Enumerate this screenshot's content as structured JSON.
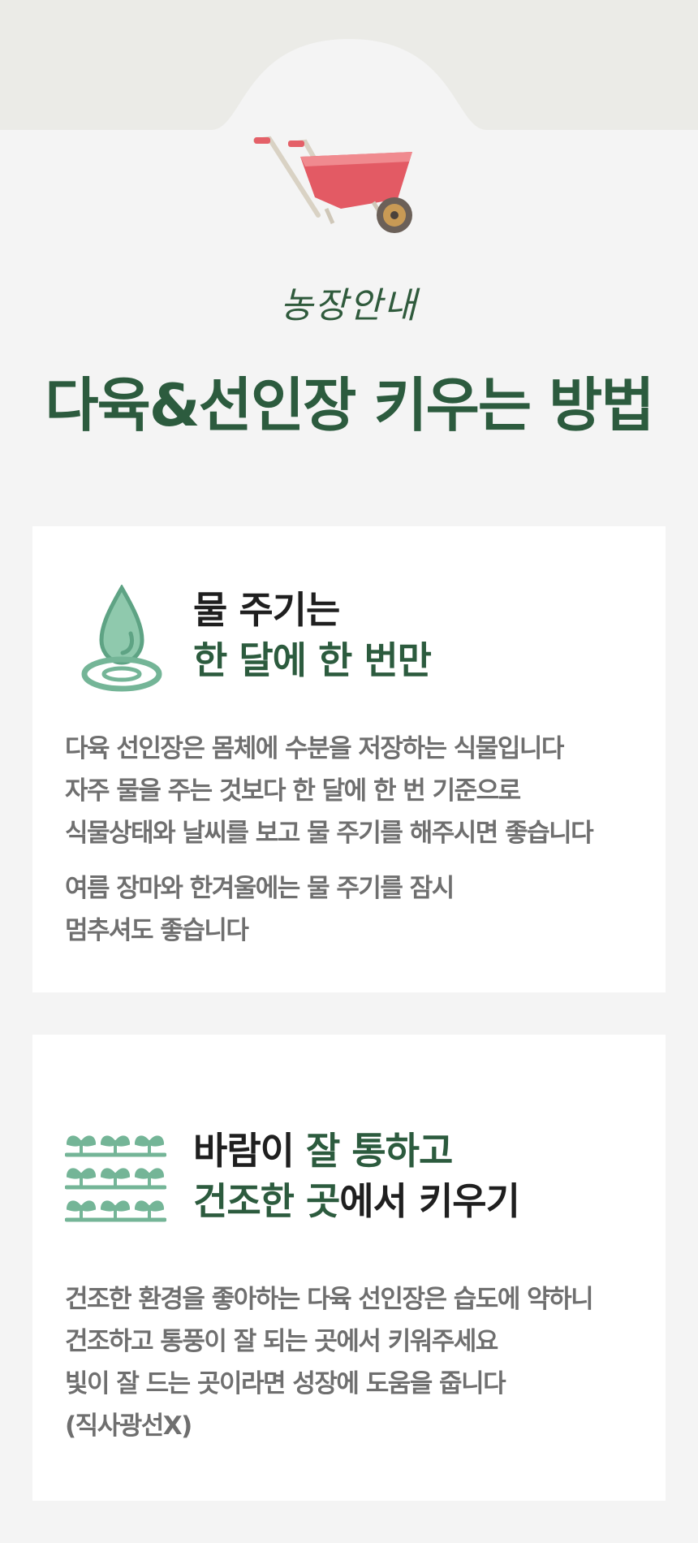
{
  "header": {
    "subtitle": "농장안내",
    "title": "다육&선인장 키우는 방법"
  },
  "colors": {
    "accent_green": "#2c5b3e",
    "icon_mint": "#74b597",
    "body_text": "#6f6f6f",
    "background": "#f4f4f4"
  },
  "cards": [
    {
      "icon": "water-drop-icon",
      "heading_line1": "물 주기는",
      "heading_line2": "한 달에 한 번만",
      "paragraphs": [
        [
          "다육 선인장은 몸체에 수분을 저장하는  식물입니다",
          "자주 물을 주는 것보다  한 달에 한 번 기준으로",
          "식물상태와 날씨를 보고 물 주기를 해주시면 좋습니다"
        ],
        [
          "여름 장마와 한겨울에는 물 주기를 잠시",
          "멈추셔도 좋습니다"
        ]
      ]
    },
    {
      "icon": "sprouts-icon",
      "heading_line1_a": "바람이 ",
      "heading_line1_b": "잘 통하고",
      "heading_line2_a": "건조한 곳",
      "heading_line2_b": "에서 키우기",
      "lines": [
        "건조한 환경을 좋아하는 다육 선인장은 습도에 약하니",
        "건조하고 통풍이 잘 되는 곳에서 키워주세요",
        "빛이 잘 드는 곳이라면 성장에 도움을 줍니다",
        "(직사광선X)"
      ]
    }
  ]
}
